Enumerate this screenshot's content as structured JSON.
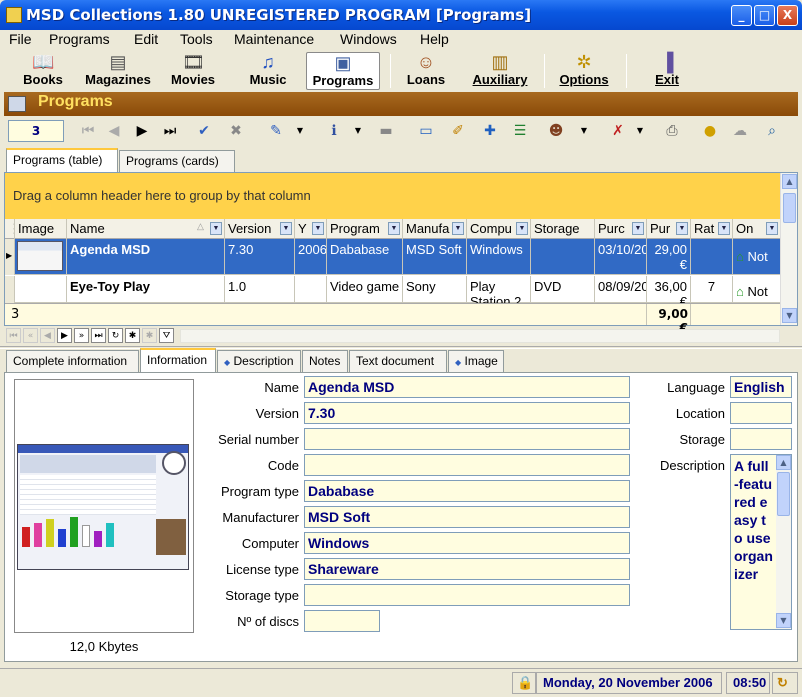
{
  "window": {
    "title": "MSD Collections 1.80 UNREGISTERED PROGRAM [Programs]",
    "minimize": "_",
    "maximize": "□",
    "close": "X"
  },
  "menu": [
    "File",
    "Programs",
    "Edit",
    "Tools",
    "Maintenance",
    "Windows",
    "Help"
  ],
  "main_toolbar": [
    {
      "label": "Books",
      "icon": "book-icon"
    },
    {
      "label": "Magazines",
      "icon": "magazine-icon"
    },
    {
      "label": "Movies",
      "icon": "film-icon"
    },
    {
      "label": "Music",
      "icon": "music-note-icon"
    },
    {
      "label": "Programs",
      "icon": "programs-icon"
    },
    {
      "label": "Loans",
      "icon": "loans-icon"
    },
    {
      "label": "Auxiliary",
      "icon": "auxiliary-icon"
    },
    {
      "label": "Options",
      "icon": "options-icon"
    },
    {
      "label": "Exit",
      "icon": "exit-icon"
    }
  ],
  "section": {
    "title": "Programs"
  },
  "nav": {
    "record": "3"
  },
  "view_tabs": [
    "Programs (table)",
    "Programs (cards)"
  ],
  "grid": {
    "group_hint": "Drag a column header here to group by that column",
    "columns": [
      "Image",
      "Name",
      "Version",
      "Y",
      "Program",
      "Manufa",
      "Compu",
      "Storage",
      "Purc",
      "Pur",
      "Rat",
      "On"
    ],
    "rows": [
      {
        "name": "Agenda MSD",
        "version": "7.30",
        "year": "2006",
        "program": "Dababase",
        "manufacturer": "MSD Soft",
        "computer": "Windows",
        "storage": "",
        "purchase_date": "03/10/20",
        "price": "29,00",
        "price_unit": "€",
        "rating": "",
        "on": "Not"
      },
      {
        "name": "Eye-Toy Play",
        "version": "1.0",
        "year": "",
        "program": "Video game",
        "manufacturer": "Sony",
        "computer": "Play",
        "computer2": "Station 2",
        "storage": "DVD",
        "purchase_date": "08/09/20",
        "price": "36,00",
        "price_unit": "€",
        "rating": "7",
        "on": "Not"
      }
    ],
    "footer_count": "3",
    "footer_total": "9,00 €"
  },
  "detail_tabs": [
    "Complete information",
    "Information",
    "Description",
    "Notes",
    "Text document",
    "Image"
  ],
  "image_size": "12,0 Kbytes",
  "fields": {
    "name_label": "Name",
    "name": "Agenda MSD",
    "version_label": "Version",
    "version": "7.30",
    "serial_label": "Serial number",
    "serial": "",
    "code_label": "Code",
    "code": "",
    "type_label": "Program type",
    "type": "Dababase",
    "manufacturer_label": "Manufacturer",
    "manufacturer": "MSD Soft",
    "computer_label": "Computer",
    "computer": "Windows",
    "license_label": "License type",
    "license": "Shareware",
    "storage_type_label": "Storage type",
    "storage_type": "",
    "discs_label": "Nº of discs",
    "discs": "",
    "language_label": "Language",
    "language": "English",
    "location_label": "Location",
    "location": "",
    "storage_label": "Storage",
    "storage": "",
    "description_label": "Description",
    "description": "A full-featured easy to use organizer"
  },
  "status": {
    "date": "Monday, 20 November 2006",
    "time": "08:50"
  }
}
